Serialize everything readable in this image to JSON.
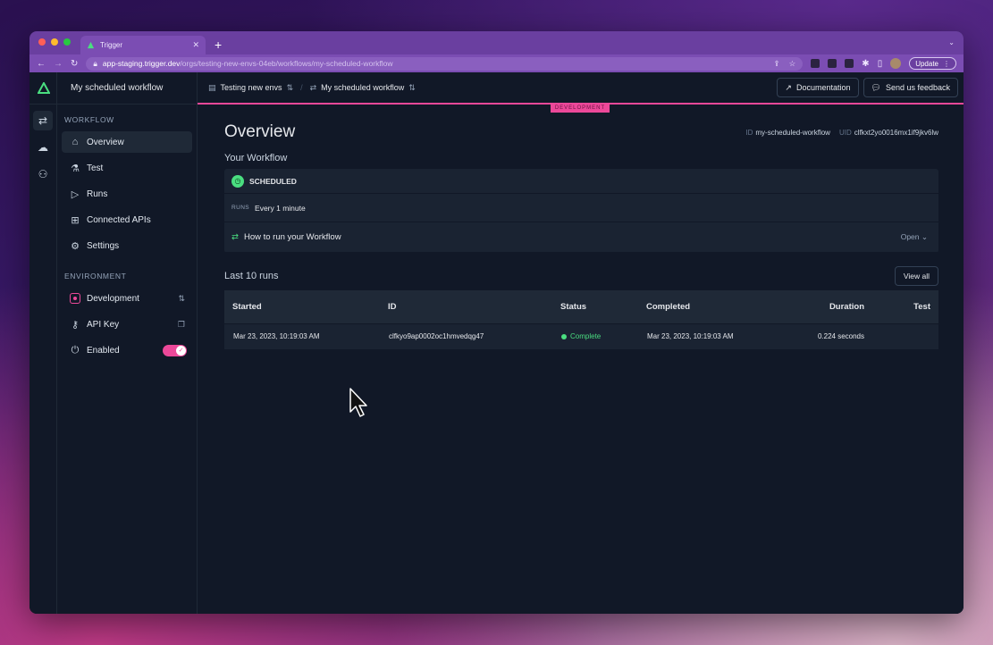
{
  "browser": {
    "tab_title": "Trigger",
    "url_host": "app-staging.trigger.dev",
    "url_path": "/orgs/testing-new-envs-04eb/workflows/my-scheduled-workflow",
    "update_label": "Update"
  },
  "sidebar": {
    "workflow_title": "My scheduled workflow",
    "workflow_section": "WORKFLOW",
    "items": [
      {
        "label": "Overview",
        "icon": "home-icon"
      },
      {
        "label": "Test",
        "icon": "flask-icon"
      },
      {
        "label": "Runs",
        "icon": "play-icon"
      },
      {
        "label": "Connected APIs",
        "icon": "grid-icon"
      },
      {
        "label": "Settings",
        "icon": "gear-icon"
      }
    ],
    "environment_section": "ENVIRONMENT",
    "env_items": [
      {
        "label": "Development"
      },
      {
        "label": "API Key"
      },
      {
        "label": "Enabled"
      }
    ]
  },
  "topbar": {
    "org": "Testing new envs",
    "workflow": "My scheduled workflow",
    "docs_label": "Documentation",
    "feedback_label": "Send us feedback",
    "env_badge": "DEVELOPMENT"
  },
  "overview": {
    "title": "Overview",
    "id_key": "ID",
    "id_value": "my-scheduled-workflow",
    "uid_key": "UID",
    "uid_value": "clfkxt2yo0016mx1if9jkv6lw",
    "your_workflow": "Your Workflow",
    "trigger_type": "SCHEDULED",
    "runs_key": "RUNS",
    "runs_value": "Every 1 minute",
    "howto": "How to run your Workflow",
    "open_label": "Open"
  },
  "runs": {
    "heading": "Last 10 runs",
    "view_all": "View all",
    "columns": [
      "Started",
      "ID",
      "Status",
      "Completed",
      "Duration",
      "Test"
    ],
    "rows": [
      {
        "started": "Mar 23, 2023, 10:19:03 AM",
        "id": "clfkyo9ap0002oc1hmvedqg47",
        "status": "Complete",
        "completed": "Mar 23, 2023, 10:19:03 AM",
        "duration": "0.224 seconds",
        "test": ""
      }
    ]
  },
  "colors": {
    "accent": "#ec4899",
    "success": "#4ade80",
    "browser_chrome": "#6a3fa0",
    "background": "#111827"
  }
}
